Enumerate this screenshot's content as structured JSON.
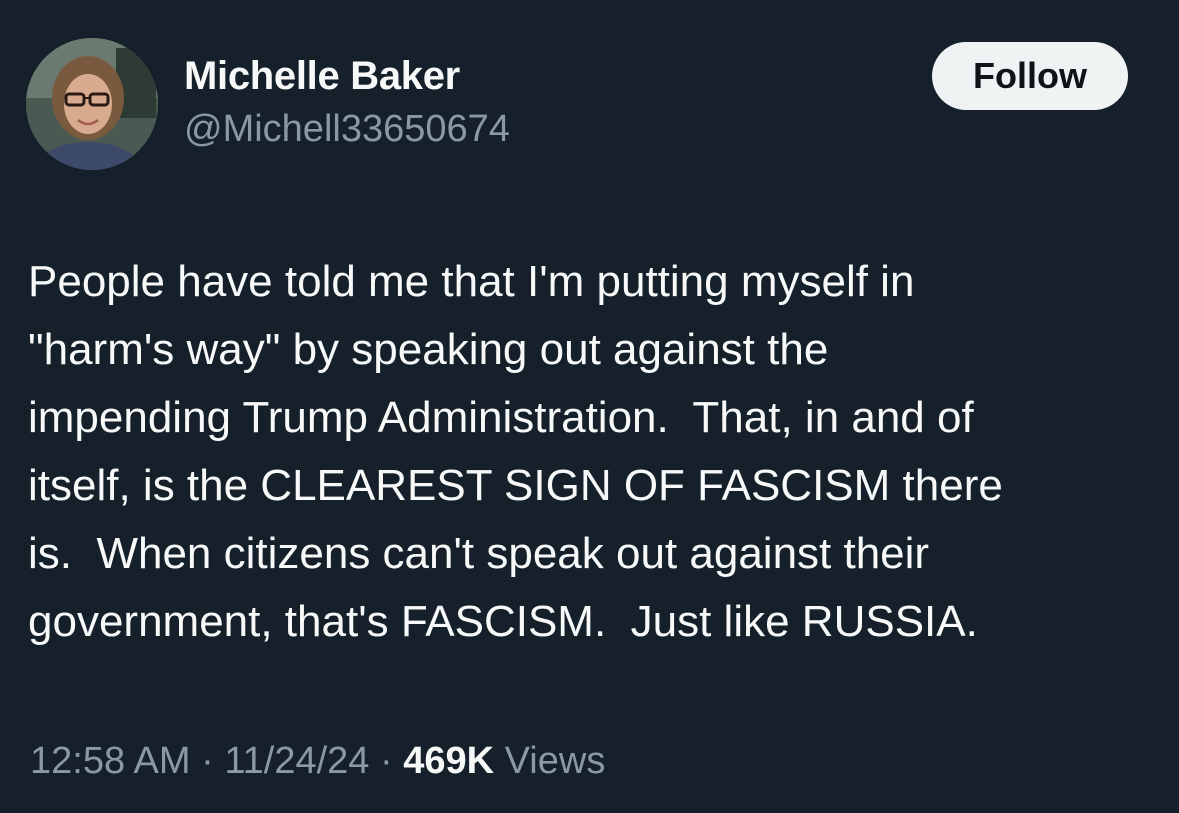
{
  "author": {
    "display_name": "Michelle Baker",
    "handle": "@Michell33650674",
    "avatar_icon": "profile-photo"
  },
  "follow_button": {
    "label": "Follow"
  },
  "tweet": {
    "text": "People have told me that I'm putting myself in\n\"harm's way\" by speaking out against the\nimpending Trump Administration.  That, in and of\nitself, is the CLEAREST SIGN OF FASCISM there\nis.  When citizens can't speak out against their\ngovernment, that's FASCISM.  Just like RUSSIA."
  },
  "meta": {
    "time": "12:58 AM",
    "separator": " · ",
    "date": "11/24/24",
    "views_count": "469K",
    "views_label": " Views"
  },
  "colors": {
    "background": "#15202b",
    "primary_text": "#f7f9f9",
    "secondary_text": "#8b98a5",
    "follow_bg": "#eff3f4"
  }
}
